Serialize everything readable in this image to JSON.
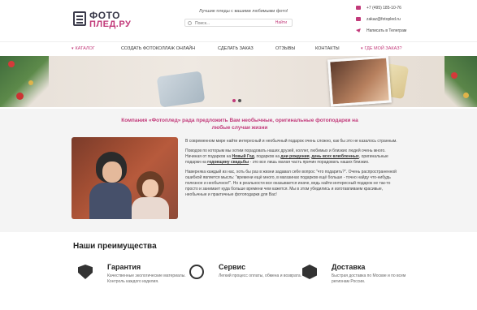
{
  "header": {
    "logo_top": "ФОТО",
    "logo_bottom": "ПЛЕД.РУ",
    "tagline": "Лучшие пледы с вашими любимыми фото!",
    "search_placeholder": "Поиск...",
    "search_button": "Найти",
    "phone": "+7 (495) 185-10-76",
    "email": "zakaz@fotopled.ru",
    "telegram": "Написать в Телеграм"
  },
  "nav": {
    "items": [
      "КАТАЛОГ",
      "СОЗДАТЬ ФОТОКОЛЛАЖ ОНЛАЙН",
      "СДЕЛАТЬ ЗАКАЗ",
      "ОТЗЫВЫ",
      "КОНТАКТЫ",
      "ГДЕ МОЙ ЗАКАЗ?"
    ]
  },
  "banner": {
    "slides_count": 2,
    "active_slide": 1
  },
  "intro": {
    "title": "Компания «Фотоплед» рада предложить Вам необычные, оригинальные фотоподарки на любые случаи жизни",
    "p1": "В современном мире найти интересный и необычный подарок очень сложно, как бы это не казалось странным.",
    "p2_a": "Поводов по которым мы хотим порадовать наших друзей, коллег, любимых и близких людей очень много. Начиная от подарков на ",
    "p2_link1": "Новый Год",
    "p2_b": ", подарков на ",
    "p2_link2": "дни рождения",
    "p2_c": ", ",
    "p2_link3": "день всех влюбленных",
    "p2_d": ", оригинальные подарки на ",
    "p2_link4": "годовщину свадьбы",
    "p2_e": " - это все лишь малая часть причин порадовать наших близких.",
    "p3": "Наверняка каждый из нас, хоть бы раз в жизни задавал себе вопрос \"что подарить?\". Очень распространенной ошибкой является мысль: \"времени ещё много, в магазинах подарков ещё больше - точно найду что-нибудь полезное и необычное!\". Но в реальности все оказывается иначе, ведь найти интересный подарок не так-то просто и занимает куда больше времени чем кажется. Мы в этом убедились и изготавливаем красивые, необычные и практичные фотоподарки для Вас!"
  },
  "advantages": {
    "title": "Наши преимущества",
    "items": [
      {
        "icon": "shield-check-icon",
        "title": "Гарантия",
        "text": "Качественные экологические материалы. Контроль каждого изделия."
      },
      {
        "icon": "operator-icon",
        "title": "Сервис",
        "text": "Легкий процесс оплаты, обмена и возврата."
      },
      {
        "icon": "box-icon",
        "title": "Доставка",
        "text": "Быстрая доставка по Москве и по всем регионам России."
      }
    ]
  },
  "colors": {
    "accent": "#c23a7a",
    "dark": "#3a3a4a"
  }
}
